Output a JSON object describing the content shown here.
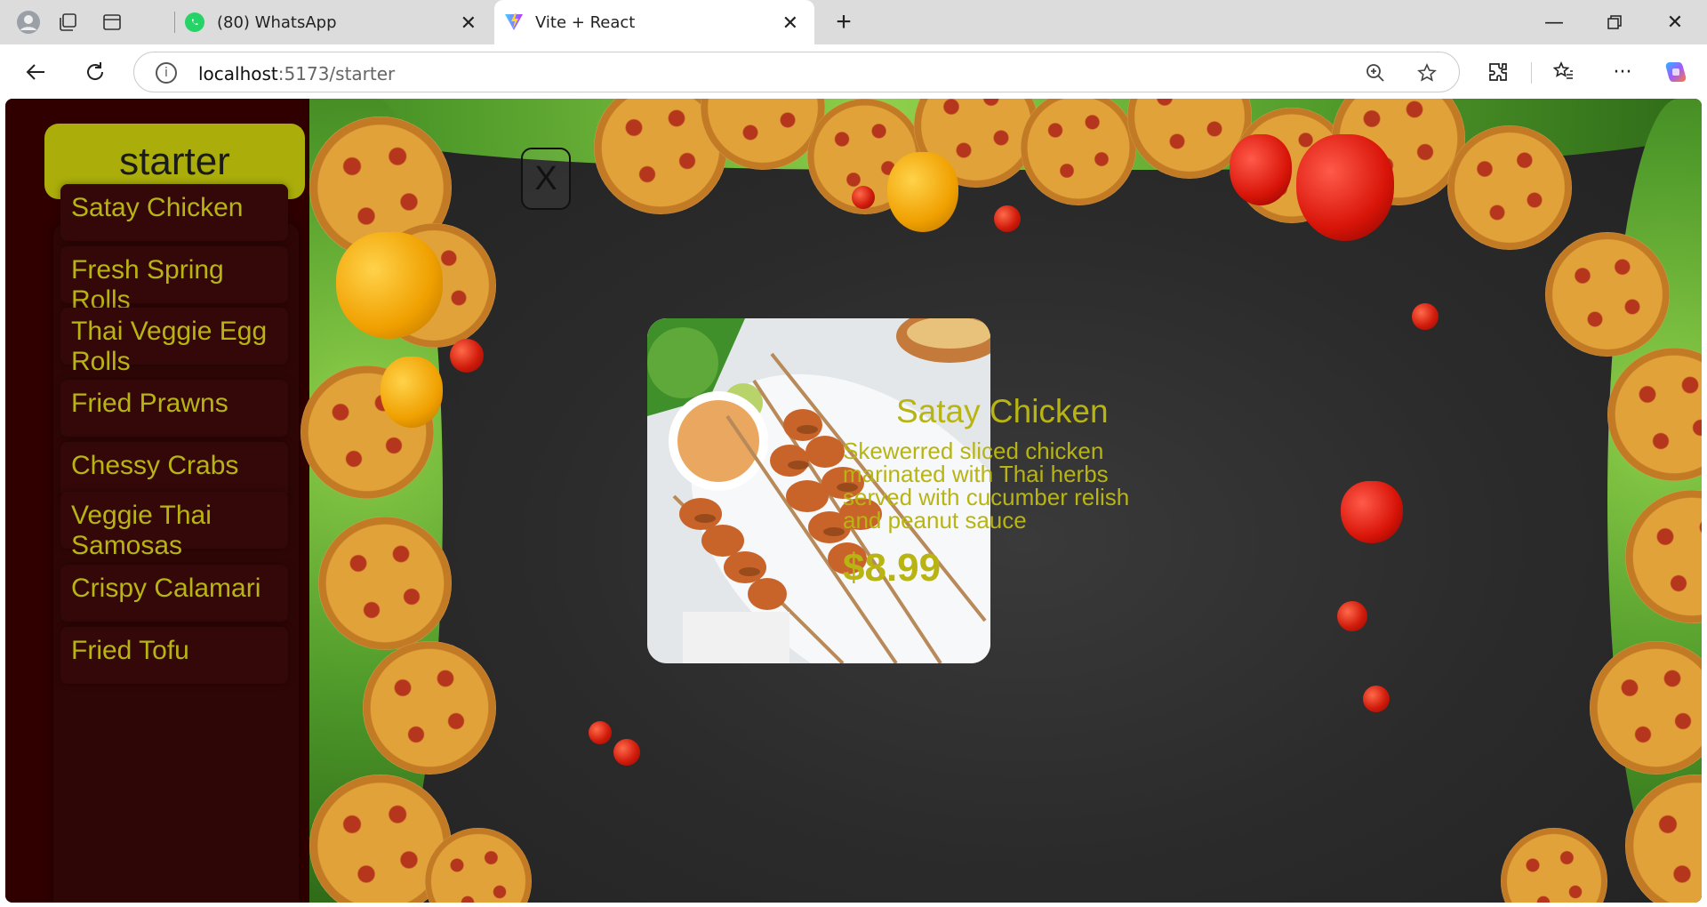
{
  "browser": {
    "tabs": [
      {
        "label": "(80) WhatsApp"
      },
      {
        "label": "Vite + React"
      }
    ],
    "url_host": "localhost",
    "url_rest": ":5173/starter"
  },
  "sidebar": {
    "category_label": "starter",
    "items": [
      {
        "label": "Satay Chicken"
      },
      {
        "label": "Fresh Spring Rolls"
      },
      {
        "label": "Thai Veggie Egg Rolls"
      },
      {
        "label": "Fried Prawns"
      },
      {
        "label": "Chessy Crabs"
      },
      {
        "label": "Veggie Thai Samosas"
      },
      {
        "label": "Crispy Calamari"
      },
      {
        "label": "Fried Tofu"
      }
    ]
  },
  "detail": {
    "close_label": "X",
    "title": "Satay Chicken",
    "description": "Skewerred sliced chicken marinated with Thai herbs served with cucumber relish and peanut sauce",
    "price": "$8.99"
  },
  "colors": {
    "accent": "#b8b413",
    "category_button": "#aaad0a",
    "sidebar_bg": "#300000",
    "stage_bg": "#2b2b2b"
  }
}
